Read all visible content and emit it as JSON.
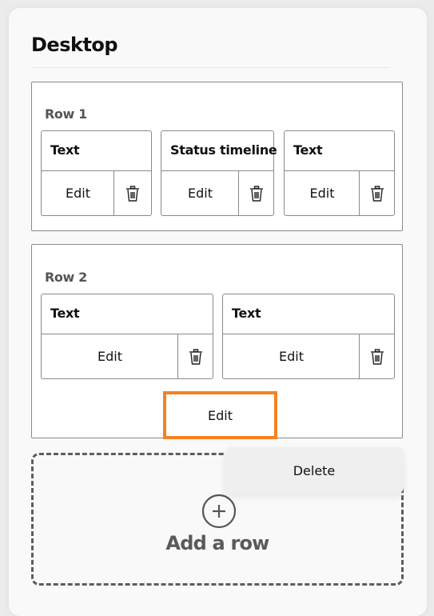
{
  "section": {
    "title": "Desktop"
  },
  "rows": [
    {
      "label": "Row 1",
      "cards": [
        {
          "title": "Text",
          "edit_label": "Edit",
          "delete_icon": "trash-icon"
        },
        {
          "title": "Status timeline",
          "edit_label": "Edit",
          "delete_icon": "trash-icon"
        },
        {
          "title": "Text",
          "edit_label": "Edit",
          "delete_icon": "trash-icon"
        }
      ]
    },
    {
      "label": "Row 2",
      "cards": [
        {
          "title": "Text",
          "edit_label": "Edit",
          "delete_icon": "trash-icon"
        },
        {
          "title": "Text",
          "edit_label": "Edit",
          "delete_icon": "trash-icon"
        }
      ],
      "edit_label": "Edit"
    }
  ],
  "add_row": {
    "label": "Add a row",
    "icon": "plus-circle-icon"
  },
  "context_menu": {
    "items": [
      {
        "label": "Delete"
      }
    ]
  },
  "colors": {
    "highlight": "#f58220",
    "border": "#8a8a8a",
    "dashed": "#5e5e5e"
  }
}
